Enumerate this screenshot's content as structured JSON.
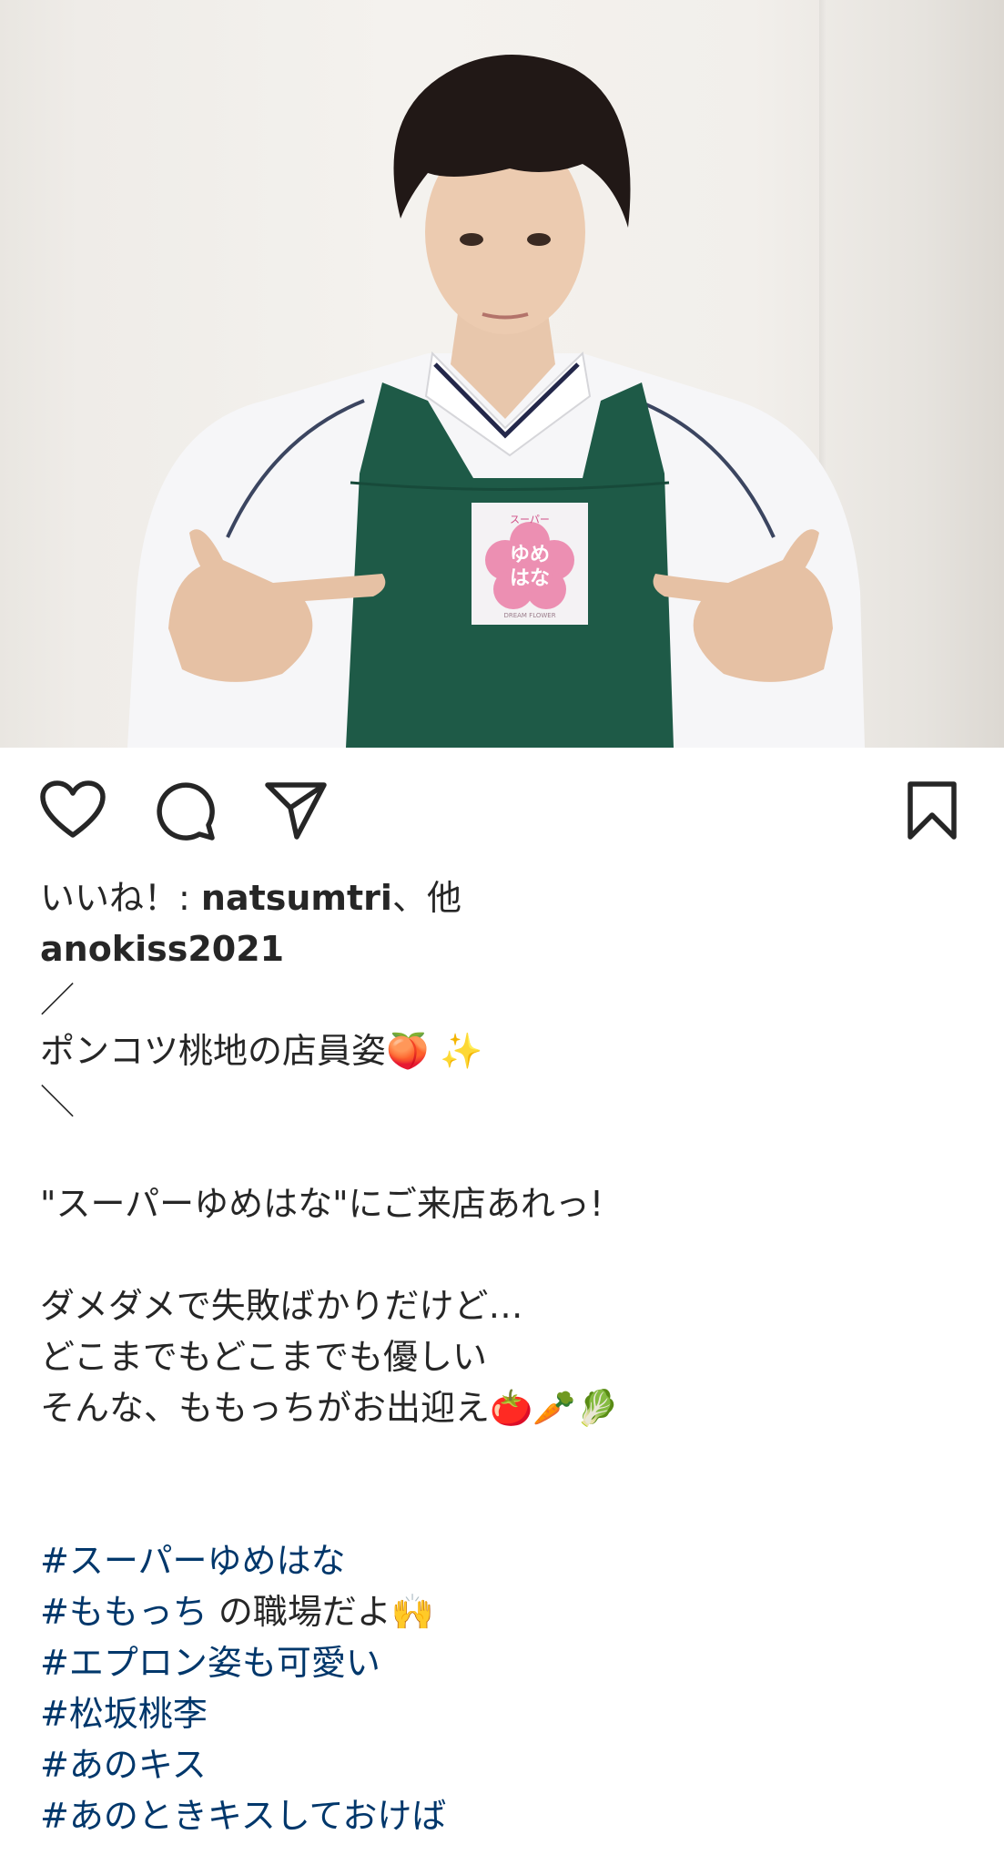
{
  "photo": {
    "alt_role": "post-image",
    "badge_top": "スーパー",
    "badge_main_1": "ゆめ",
    "badge_main_2": "はな",
    "badge_bottom": "DREAM FLOWER",
    "apron_color": "#1e5a47",
    "badge_pink": "#ec8fb2"
  },
  "actions": {
    "like_icon": "heart-outline-icon",
    "comment_icon": "comment-bubble-icon",
    "share_icon": "paper-plane-icon",
    "save_icon": "bookmark-icon"
  },
  "likes": {
    "prefix": "いいね！: ",
    "name": "natsumtri",
    "suffix": "、他"
  },
  "caption": {
    "username": "anokiss2021",
    "line1": "／",
    "line2": "ポンコツ桃地の店員姿",
    "line2_emoji": "🍑 ✨",
    "line3": "＼",
    "line4": "\"スーパーゆめはな\"にご来店あれっ!",
    "line5": "ダメダメで失敗ばかりだけど…",
    "line6": "どこまでもどこまでも優しい",
    "line7": "そんな、ももっちがお出迎え",
    "line7_emoji": "🍅🥕🥬"
  },
  "hashtags": [
    {
      "text": "#スーパーゆめはな",
      "after": ""
    },
    {
      "text": "#ももっち",
      "after": " の職場だよ🙌"
    },
    {
      "text": "#エプロン姿も可愛い",
      "after": ""
    },
    {
      "text": "#松坂桃李",
      "after": ""
    },
    {
      "text": "#あのキス",
      "after": ""
    },
    {
      "text": "#あのときキスしておけば",
      "after": ""
    }
  ]
}
